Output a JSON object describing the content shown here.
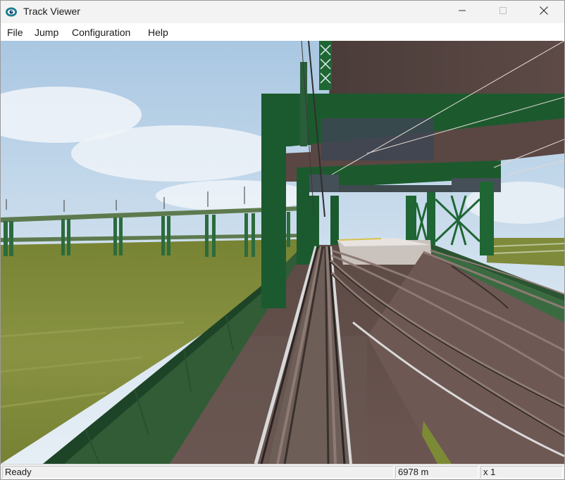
{
  "window": {
    "title": "Track Viewer",
    "icon": "eye-icon"
  },
  "title_controls": {
    "minimize_icon": "minimize-icon",
    "maximize_icon": "maximize-icon",
    "close_icon": "close-icon"
  },
  "menu": {
    "items": [
      {
        "label": "File"
      },
      {
        "label": "Jump"
      },
      {
        "label": "Configuration"
      },
      {
        "label": "Help"
      }
    ]
  },
  "viewport": {
    "description_kind": "3d-rail-scene"
  },
  "status": {
    "state": "Ready",
    "distance": "6978 m",
    "multiplier": "x 1"
  },
  "colors": {
    "sky": "#c9dcef",
    "grass": "#7d8a35",
    "structure_green": "#1b5a2e",
    "deck_brown": "#6b5550",
    "rail": "#8e7a74"
  }
}
